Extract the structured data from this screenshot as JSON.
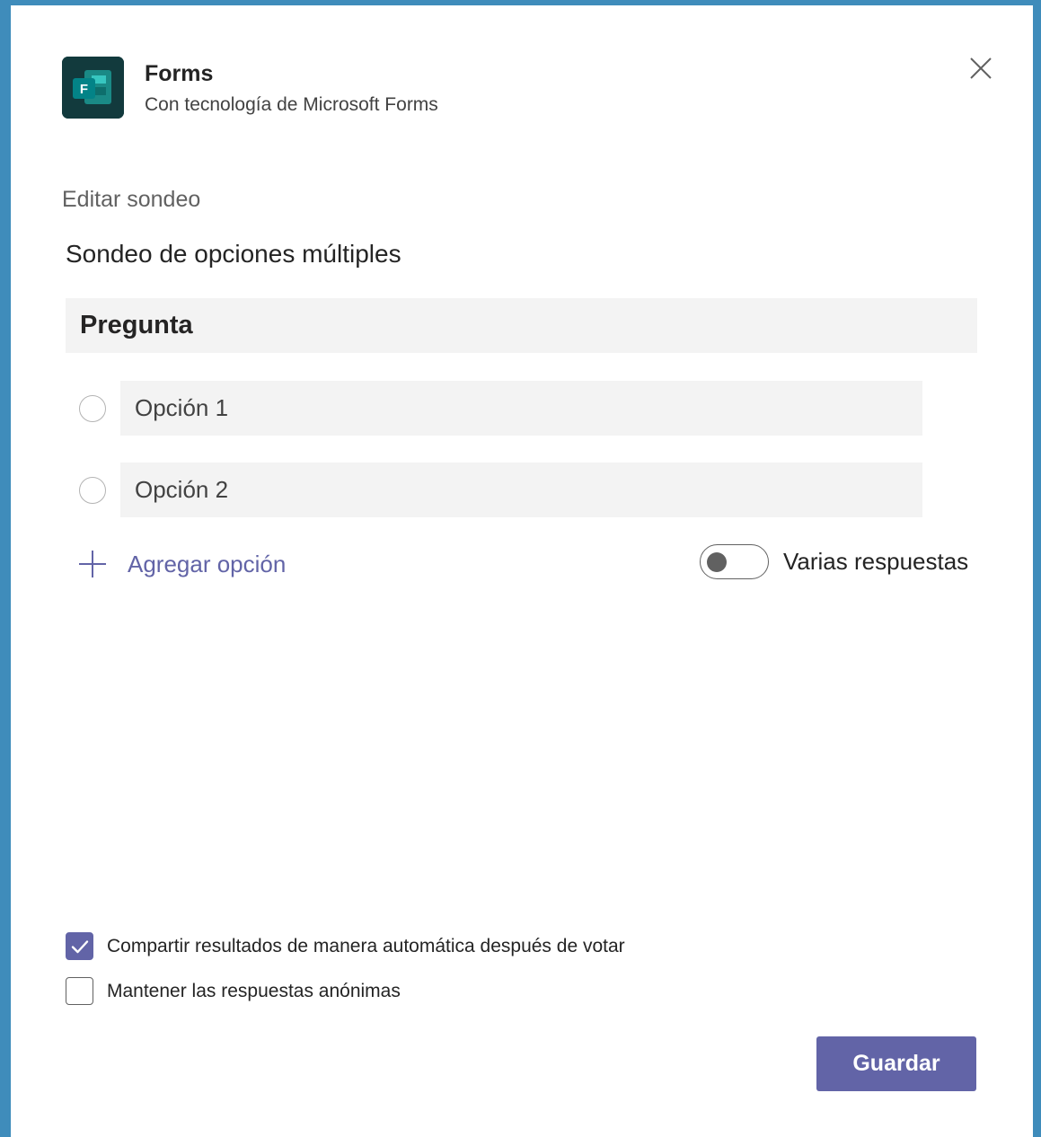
{
  "app": {
    "name": "Forms",
    "subtitle": "Con tecnología de Microsoft Forms",
    "icon": "microsoft-forms-icon"
  },
  "dialog": {
    "section_label": "Editar sondeo",
    "poll_title": "Sondeo de opciones múltiples"
  },
  "question": {
    "placeholder": "Pregunta",
    "value": ""
  },
  "options": [
    {
      "placeholder": "Opción 1",
      "value": ""
    },
    {
      "placeholder": "Opción 2",
      "value": ""
    }
  ],
  "add_option_label": "Agregar opción",
  "multiple_answers": {
    "label": "Varias respuestas",
    "enabled": false
  },
  "settings": [
    {
      "label": "Compartir resultados de manera automática después de votar",
      "checked": true
    },
    {
      "label": "Mantener las respuestas anónimas",
      "checked": false
    }
  ],
  "save_label": "Guardar",
  "colors": {
    "accent": "#6264a7",
    "background": "#3f8cbb",
    "field": "#f3f3f3",
    "forms_icon": "#123a3d"
  }
}
